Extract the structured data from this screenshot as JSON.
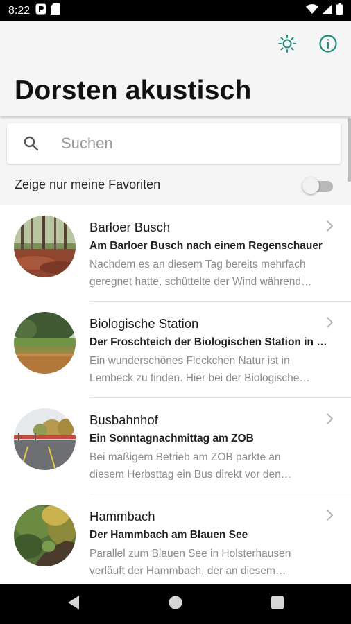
{
  "status_bar": {
    "time": "8:22",
    "icons": [
      "app-notification-icon",
      "sd-card-icon",
      "wifi-icon",
      "signal-icon",
      "battery-icon"
    ]
  },
  "app_bar": {
    "title": "Dorsten akustisch",
    "actions": [
      "brightness-icon",
      "info-icon"
    ],
    "accent_color": "#1e8c7e"
  },
  "search": {
    "placeholder": "Suchen",
    "value": ""
  },
  "favorites_filter": {
    "label": "Zeige nur meine Favoriten",
    "enabled": false
  },
  "list": {
    "items": [
      {
        "title": "Barloer Busch",
        "subtitle": "Am Barloer Busch nach einem Regenschauer",
        "description_lines": [
          "Nachdem es an diesem Tag bereits mehrfach",
          "geregnet hatte, schüttelte der Wind während…"
        ]
      },
      {
        "title": "Biologische Station",
        "subtitle": "Der Froschteich der Biologischen Station in …",
        "description_lines": [
          "Ein wunderschönes Fleckchen Natur ist in",
          "Lembeck zu finden. Hier bei der Biologische…"
        ]
      },
      {
        "title": "Busbahnhof",
        "subtitle": "Ein Sonntagnachmittag am ZOB",
        "description_lines": [
          "Bei mäßigem Betrieb am ZOB parkte an",
          "diesem Herbsttag ein Bus direkt vor den…"
        ]
      },
      {
        "title": "Hammbach",
        "subtitle": "Der Hammbach am Blauen See",
        "description_lines": [
          "Parallel zum Blauen See in Holsterhausen",
          "verläuft der Hammbach, der an diesem…"
        ]
      }
    ]
  },
  "nav_bar": {
    "buttons": [
      "back-icon",
      "home-icon",
      "recents-icon"
    ]
  }
}
